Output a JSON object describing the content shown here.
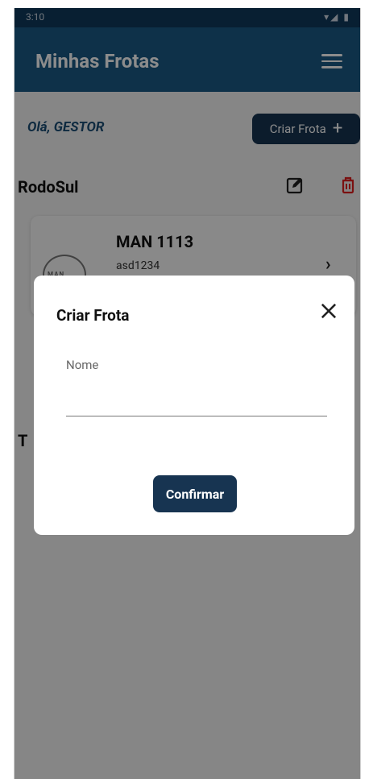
{
  "status_bar": {
    "time": "3:10",
    "icons": "▾◢ ▮"
  },
  "app_bar": {
    "title": "Minhas Frotas"
  },
  "greeting": "Olá, GESTOR",
  "create_fleet_button": {
    "label": "Criar Frota",
    "icon": "+"
  },
  "fleet": {
    "name": "RodoSul",
    "vehicles": [
      {
        "model": "MAN 1113",
        "plate": "asd1234",
        "logo_text": "MAN"
      }
    ]
  },
  "background_second_fleet_initial": "T",
  "modal": {
    "title": "Criar Frota",
    "field_label": "Nome",
    "field_value": "",
    "confirm_label": "Confirmar"
  },
  "colors": {
    "app_bar": "#1a5a85",
    "status_bar": "#0f3a5c",
    "button": "#173451",
    "delete": "#e02020",
    "greeting": "#1a4d75"
  }
}
